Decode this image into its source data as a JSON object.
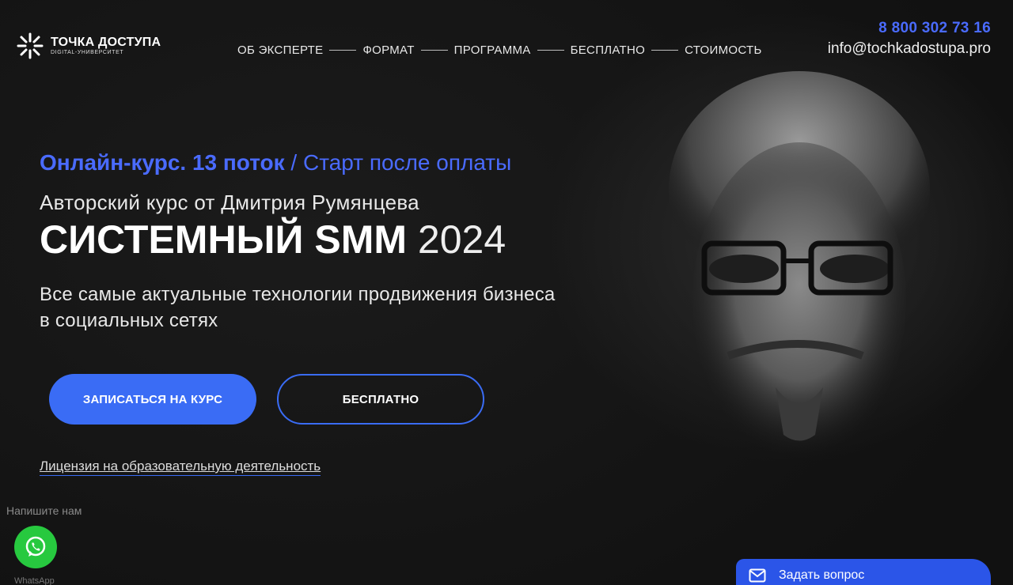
{
  "brand": {
    "name": "ТОЧКА ДОСТУПА",
    "subtitle": "DIGITAL-УНИВЕРСИТЕТ"
  },
  "nav": {
    "items": [
      {
        "label": "ОБ ЭКСПЕРТЕ"
      },
      {
        "label": "ФОРМАТ"
      },
      {
        "label": "ПРОГРАММА"
      },
      {
        "label": "БЕСПЛАТНО"
      },
      {
        "label": "СТОИМОСТЬ"
      }
    ]
  },
  "contacts": {
    "phone": "8 800 302 73 16",
    "email": "info@tochkadostupa.pro"
  },
  "hero": {
    "tagline_bold": "Онлайн-курс. 13 поток",
    "tagline_rest": " / Старт после оплаты",
    "author": "Авторский курс от Дмитрия Румянцева",
    "title_bold": "СИСТЕМНЫЙ SMM",
    "title_year": " 2024",
    "subtitle": "Все самые актуальные технологии продвижения бизнеса в социальных сетях",
    "primary_button": "ЗАПИСАТЬСЯ НА КУРС",
    "secondary_button": "БЕСПЛАТНО",
    "license_link": "Лицензия на образовательную деятельность"
  },
  "widgets": {
    "whatsapp_caption": "Напишите нам",
    "whatsapp_label": "WhatsApp",
    "ask_question": "Задать вопрос"
  },
  "colors": {
    "accent": "#3a6cf5",
    "accent_text": "#4a6bff",
    "background": "#141414",
    "whatsapp": "#27c93f"
  },
  "icons": [
    "logo-mark-icon",
    "whatsapp-icon",
    "mail-icon"
  ]
}
